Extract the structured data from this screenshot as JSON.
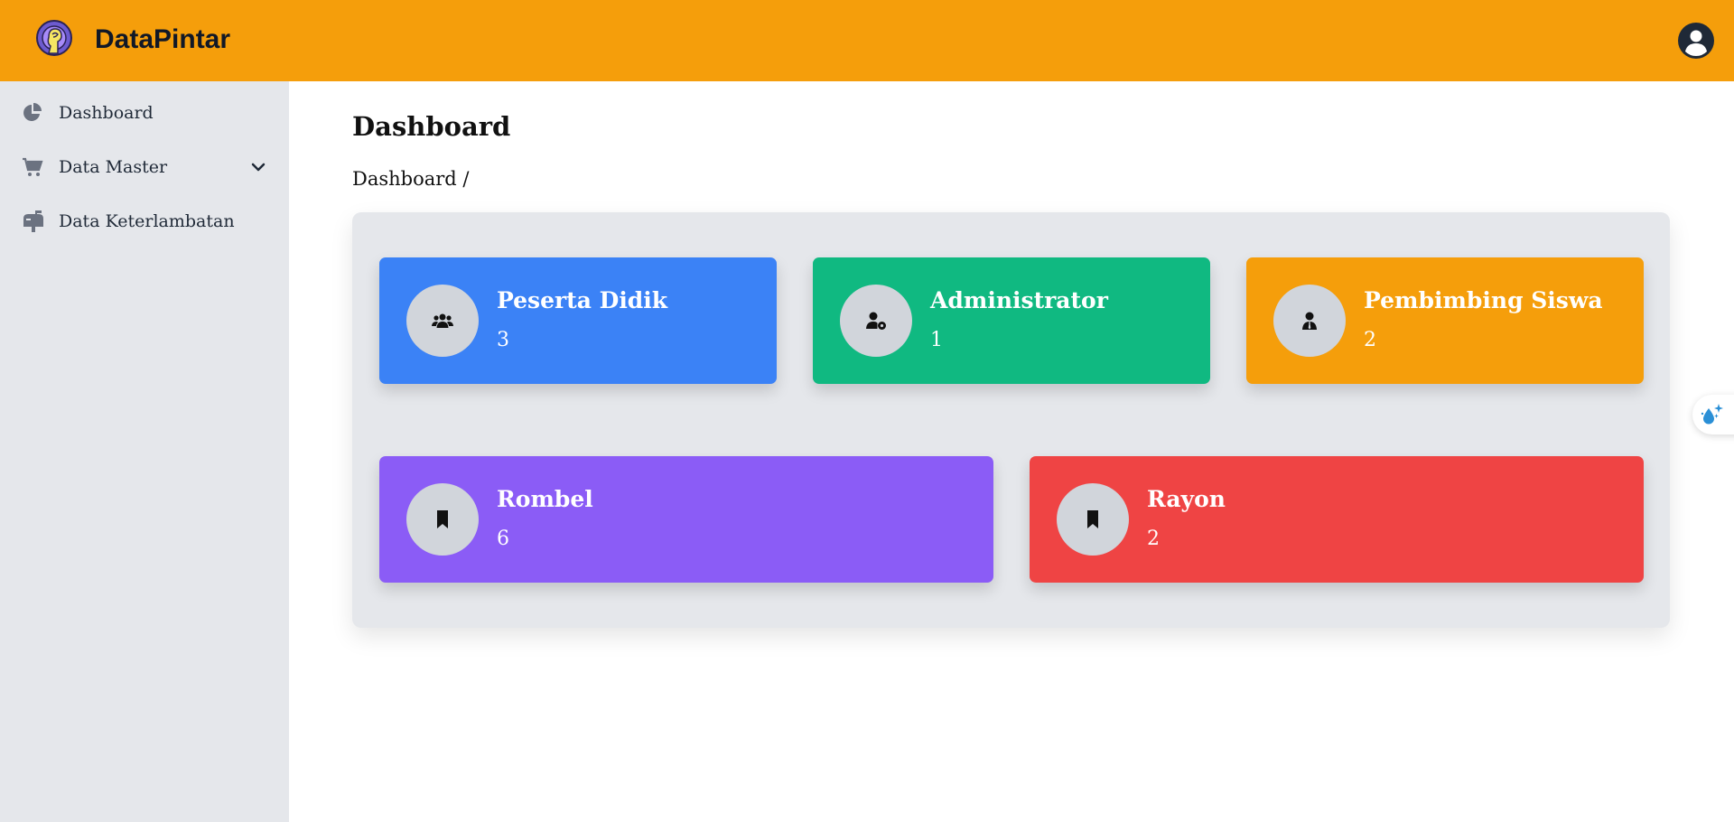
{
  "app": {
    "brand": "DataPintar",
    "colors": {
      "header": "#f59e0b",
      "sidebar": "#e5e7eb",
      "panel": "#e5e7eb"
    }
  },
  "header": {
    "logo_icon": "brain-head-icon",
    "profile_icon": "user-circle-icon"
  },
  "sidebar": {
    "items": [
      {
        "label": "Dashboard",
        "icon": "pie-chart-icon"
      },
      {
        "label": "Data Master",
        "icon": "cart-icon",
        "expandable": true
      },
      {
        "label": "Data Keterlambatan",
        "icon": "mailbox-icon"
      }
    ]
  },
  "main": {
    "title": "Dashboard",
    "breadcrumb": "Dashboard /",
    "cards": [
      {
        "title": "Peserta Didik",
        "value": "3",
        "color": "#3b82f6",
        "icon": "users-icon"
      },
      {
        "title": "Administrator",
        "value": "1",
        "color": "#10b981",
        "icon": "user-gear-icon"
      },
      {
        "title": "Pembimbing Siswa",
        "value": "2",
        "color": "#f59e0b",
        "icon": "user-tie-icon"
      },
      {
        "title": "Rombel",
        "value": "6",
        "color": "#8b5cf6",
        "icon": "bookmark-icon"
      },
      {
        "title": "Rayon",
        "value": "2",
        "color": "#ef4444",
        "icon": "bookmark-icon"
      }
    ]
  },
  "floating": {
    "icon": "droplet-sparkle-icon"
  }
}
